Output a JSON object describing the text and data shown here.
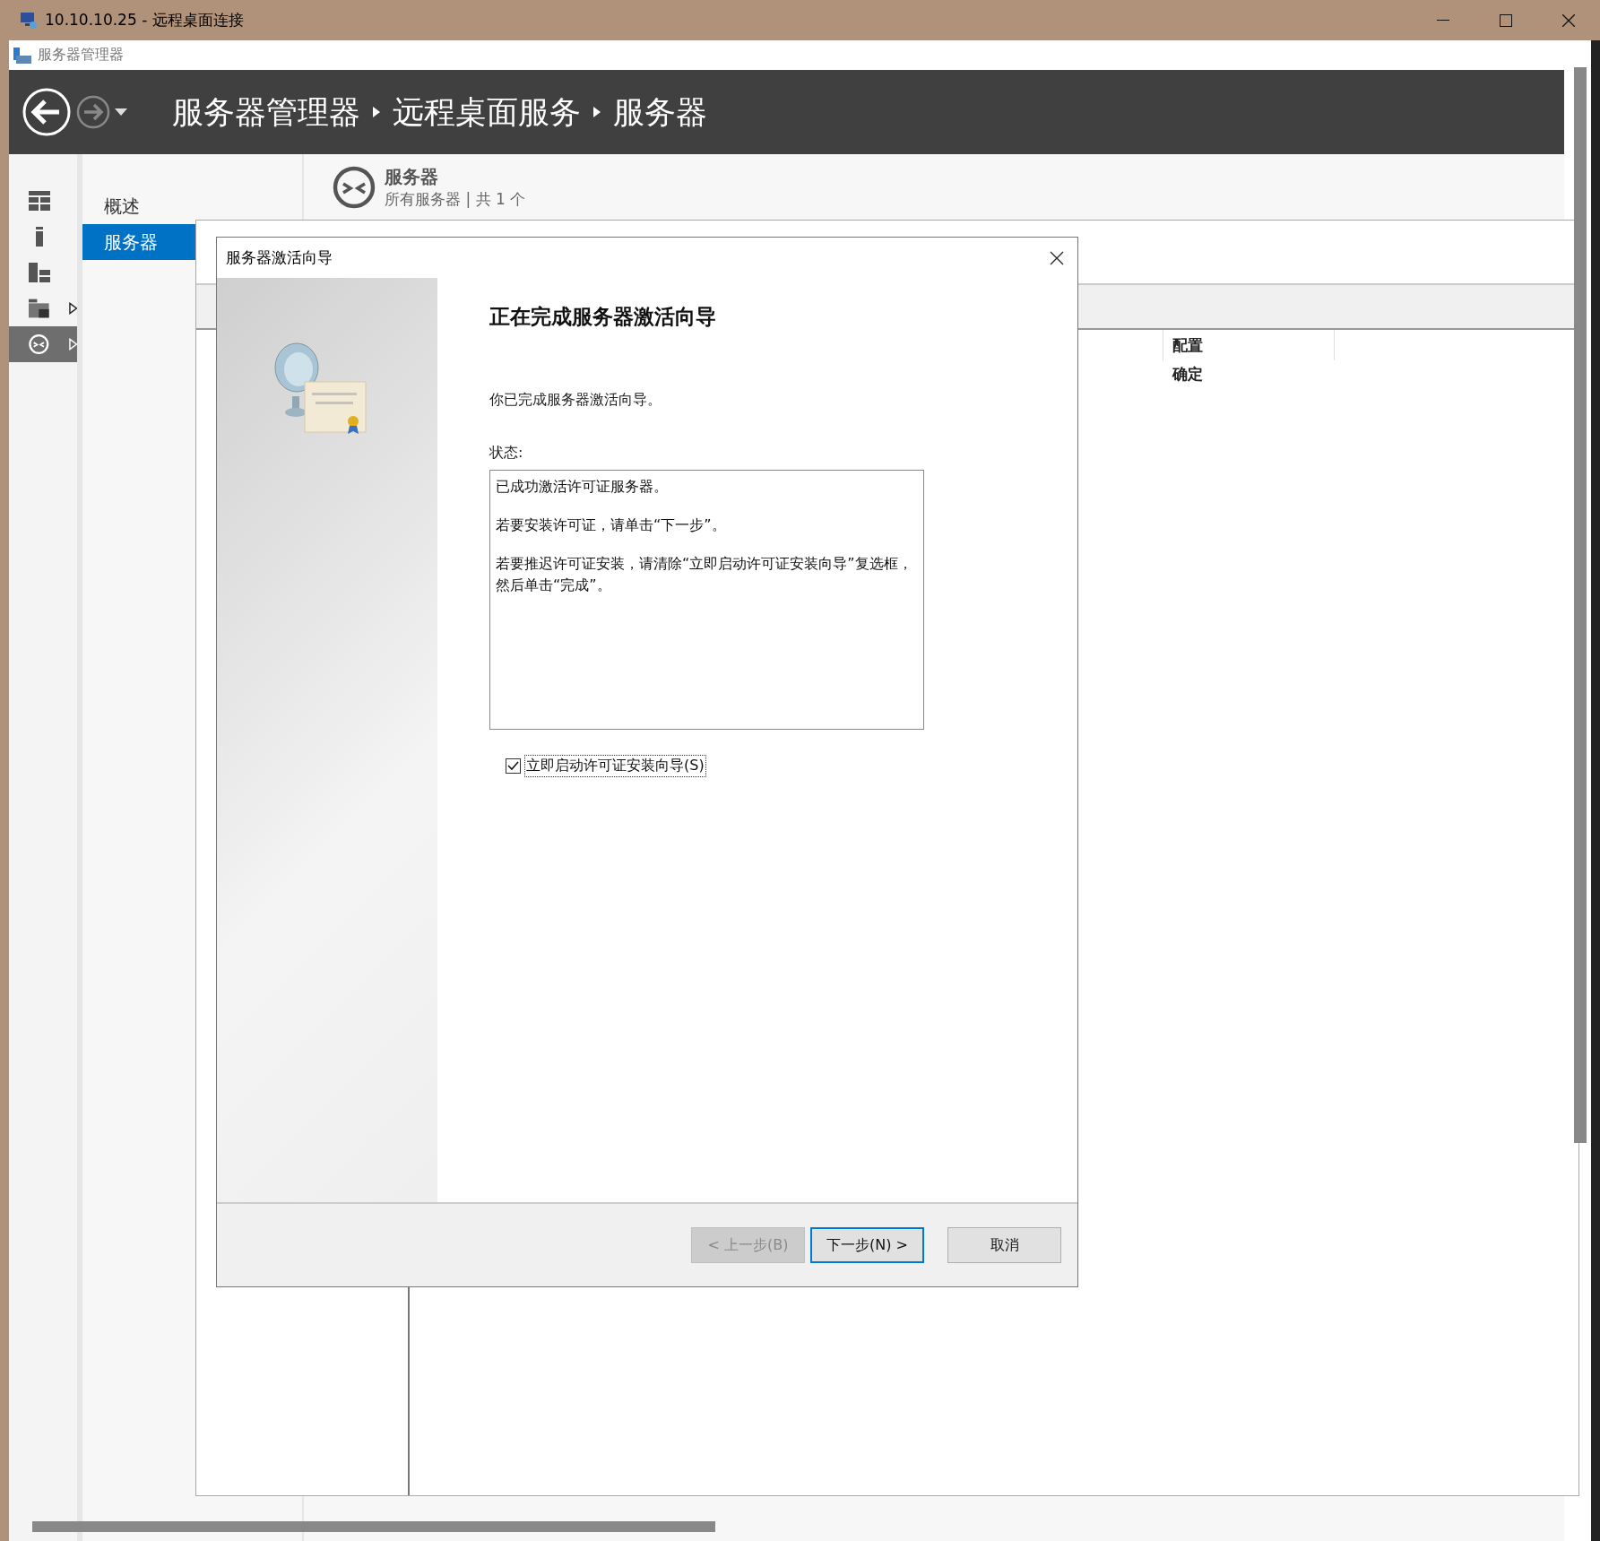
{
  "window": {
    "title": "10.10.10.25 - 远程桌面连接"
  },
  "app": {
    "title": "服务器管理器"
  },
  "breadcrumb": [
    "服务器管理器",
    "远程桌面服务",
    "服务器"
  ],
  "icon_rail": [
    {
      "kind": "dashboard",
      "selected": false,
      "expandable": false
    },
    {
      "kind": "local",
      "selected": false,
      "expandable": false
    },
    {
      "kind": "all",
      "selected": false,
      "expandable": false
    },
    {
      "kind": "roles",
      "selected": false,
      "expandable": true
    },
    {
      "kind": "remote",
      "selected": true,
      "expandable": true
    }
  ],
  "nav": [
    {
      "label": "概述",
      "selected": false
    },
    {
      "label": "服务器",
      "selected": true
    }
  ],
  "section": {
    "title": "服务器",
    "subtitle": "所有服务器 | 共 1 个"
  },
  "table": {
    "columns": [
      "配置"
    ],
    "rows": [
      [
        "确定"
      ]
    ]
  },
  "dialog": {
    "title": "服务器激活向导",
    "heading": "正在完成服务器激活向导",
    "intro": "你已完成服务器激活向导。",
    "status_label": "状态:",
    "status_text": [
      "已成功激活许可证服务器。",
      "若要安装许可证，请单击“下一步”。",
      "若要推迟许可证安装，请清除“立即启动许可证安装向导”复选框，然后单击“完成”。"
    ],
    "checkbox": {
      "label": "立即启动许可证安装向导(S)",
      "checked": true
    },
    "buttons": [
      {
        "label": "< 上一步(B)",
        "disabled": true,
        "default": false
      },
      {
        "label": "下一步(N) >",
        "disabled": false,
        "default": true
      },
      {
        "label": "取消",
        "disabled": false,
        "default": false
      }
    ]
  }
}
